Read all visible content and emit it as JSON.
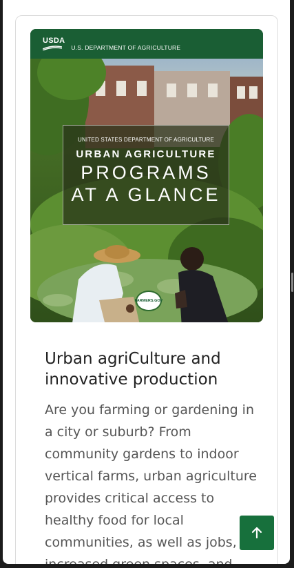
{
  "cover": {
    "agency_mark": "USDA",
    "department": "U.S. DEPARTMENT OF AGRICULTURE",
    "kicker": "UNITED STATES DEPARTMENT OF AGRICULTURE",
    "title_line1": "URBAN AGRICULTURE",
    "title_line2": "PROGRAMS",
    "title_line3": "AT A GLANCE",
    "badge": "FARMERS.GOV"
  },
  "card": {
    "title": "Urban agriCulture and innovative production",
    "body": "Are you farming or gardening in a city or suburb? From community gardens to indoor vertical farms, urban agriculture provides critical access to healthy food for local communities, as well as jobs, increased green spaces, and"
  },
  "controls": {
    "back_to_top_icon": "arrow-up-icon"
  },
  "colors": {
    "usda_green": "#1a5e34",
    "button_green": "#17703c",
    "title_text": "#222222",
    "body_text": "#555555"
  }
}
